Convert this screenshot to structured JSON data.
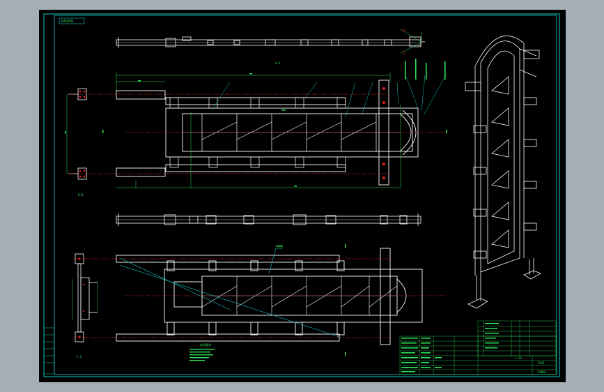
{
  "drawing": {
    "title_tag": "PAGE01",
    "view_a_label": "A-A",
    "view_b_label": "B-B",
    "view_c_label": "C-C",
    "notes_title": "技术要求",
    "title_block": {
      "drawing_no": "ZL01",
      "part_name": "PAR01",
      "sheet_label": "1:10"
    }
  },
  "colors": {
    "background": "#a5aeb6",
    "paper": "#000000",
    "border": "#18c8c8",
    "lines": "#ffffff",
    "centerline": "#e02020",
    "dimension": "#2de35a",
    "leader": "#18c8c8",
    "anchor": "#e02020"
  }
}
